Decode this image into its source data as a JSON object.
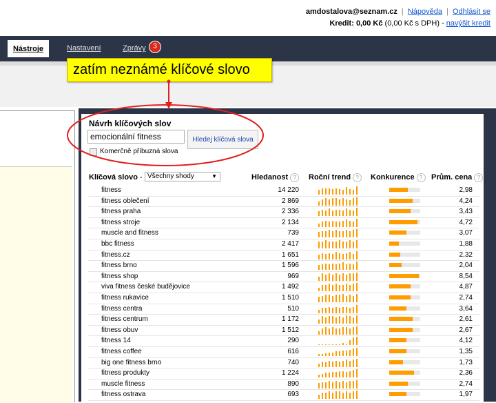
{
  "header": {
    "email": "amdostalova@seznam.cz",
    "help_link": "Nápověda",
    "logout_link": "Odhlásit se",
    "credit_label": "Kredit: 0,00 Kč",
    "credit_detail": "(0,00 Kč s DPH)",
    "credit_separator": "-",
    "topup_link": "navýšit kredit"
  },
  "tabs": [
    {
      "label": "Nástroje",
      "active": true
    },
    {
      "label": "Nastavení",
      "active": false
    },
    {
      "label": "Zprávy",
      "active": false
    }
  ],
  "notifications_badge": "3",
  "callout": {
    "text": "zatím neznámé klíčové slovo"
  },
  "suggest_panel": {
    "title": "Návrh klíčových slov",
    "input_value": "emocionální fitness",
    "search_button": "Hledej klíčová slova",
    "checkbox_label": "Komerčně příbuzná slova",
    "checkbox_checked": false
  },
  "table": {
    "col_keyword": "Klíčová slovo",
    "col_keyword_sep": "-",
    "filter_value": "Všechny shody",
    "col_searches": "Hledanost",
    "col_trend": "Roční trend",
    "col_competition": "Konkurence",
    "col_cpc": "Prům. cena",
    "help_icon": "?",
    "rows": [
      {
        "keyword": "fitness",
        "searches": "14 220",
        "competition": 0.6,
        "cpc": "2,98",
        "trend": [
          5,
          7,
          7,
          7,
          6,
          7,
          6,
          5,
          8,
          6,
          5,
          9
        ]
      },
      {
        "keyword": "fitness oblečení",
        "searches": "2 869",
        "competition": 0.75,
        "cpc": "4,24",
        "trend": [
          4,
          6,
          7,
          6,
          7,
          7,
          6,
          7,
          6,
          5,
          7,
          8
        ]
      },
      {
        "keyword": "fitness praha",
        "searches": "2 336",
        "competition": 0.7,
        "cpc": "3,43",
        "trend": [
          5,
          7,
          6,
          8,
          6,
          7,
          7,
          6,
          8,
          7,
          6,
          9
        ]
      },
      {
        "keyword": "fitness stroje",
        "searches": "2 134",
        "competition": 0.9,
        "cpc": "4,72",
        "trend": [
          4,
          6,
          7,
          6,
          7,
          6,
          6,
          7,
          8,
          7,
          6,
          9
        ]
      },
      {
        "keyword": "muscle and fitness",
        "searches": "739",
        "competition": 0.55,
        "cpc": "3,07",
        "trend": [
          5,
          6,
          6,
          7,
          6,
          7,
          6,
          6,
          7,
          6,
          7,
          8
        ]
      },
      {
        "keyword": "bbc fitness",
        "searches": "2 417",
        "competition": 0.3,
        "cpc": "1,88",
        "trend": [
          6,
          6,
          7,
          6,
          6,
          6,
          7,
          6,
          6,
          7,
          6,
          7
        ]
      },
      {
        "keyword": "fitness.cz",
        "searches": "1 651",
        "competition": 0.35,
        "cpc": "2,32",
        "trend": [
          5,
          7,
          6,
          7,
          6,
          8,
          7,
          6,
          7,
          8,
          6,
          9
        ]
      },
      {
        "keyword": "fitness brno",
        "searches": "1 596",
        "competition": 0.4,
        "cpc": "2,04",
        "trend": [
          5,
          6,
          7,
          6,
          7,
          6,
          7,
          8,
          6,
          7,
          6,
          9
        ]
      },
      {
        "keyword": "fitness shop",
        "searches": "969",
        "competition": 0.95,
        "cpc": "8,54",
        "trend": [
          4,
          7,
          6,
          7,
          6,
          7,
          6,
          7,
          6,
          7,
          7,
          8
        ]
      },
      {
        "keyword": "viva fitness české budějovice",
        "searches": "1 492",
        "competition": 0.7,
        "cpc": "4,87",
        "trend": [
          3,
          6,
          6,
          7,
          6,
          7,
          6,
          6,
          7,
          6,
          7,
          8
        ]
      },
      {
        "keyword": "fitness rukavice",
        "searches": "1 510",
        "competition": 0.7,
        "cpc": "2,74",
        "trend": [
          5,
          6,
          7,
          7,
          6,
          7,
          7,
          8,
          6,
          7,
          6,
          8
        ]
      },
      {
        "keyword": "fitness centra",
        "searches": "510",
        "competition": 0.55,
        "cpc": "3,64",
        "trend": [
          4,
          6,
          6,
          7,
          6,
          7,
          6,
          7,
          7,
          6,
          7,
          9
        ]
      },
      {
        "keyword": "fitness centrum",
        "searches": "1 172",
        "competition": 0.75,
        "cpc": "2,61",
        "trend": [
          4,
          7,
          6,
          7,
          7,
          6,
          7,
          6,
          8,
          7,
          6,
          8
        ]
      },
      {
        "keyword": "fitness obuv",
        "searches": "1 512",
        "competition": 0.75,
        "cpc": "2,67",
        "trend": [
          3,
          6,
          7,
          6,
          7,
          6,
          6,
          7,
          7,
          6,
          7,
          8
        ]
      },
      {
        "keyword": "fitness 14",
        "searches": "290",
        "competition": 0.55,
        "cpc": "4,12",
        "trend": [
          1,
          1,
          1,
          1,
          1,
          1,
          1,
          2,
          1,
          5,
          8,
          9
        ]
      },
      {
        "keyword": "fitness coffee",
        "searches": "616",
        "competition": 0.55,
        "cpc": "1,35",
        "trend": [
          2,
          2,
          3,
          4,
          4,
          5,
          5,
          6,
          6,
          7,
          8,
          9
        ]
      },
      {
        "keyword": "big one fitness brno",
        "searches": "740",
        "competition": 0.45,
        "cpc": "1,73",
        "trend": [
          4,
          6,
          5,
          7,
          6,
          7,
          6,
          7,
          8,
          7,
          8,
          9
        ]
      },
      {
        "keyword": "fitness produkty",
        "searches": "1 224",
        "competition": 0.8,
        "cpc": "2,36",
        "trend": [
          3,
          4,
          5,
          5,
          6,
          6,
          7,
          7,
          6,
          7,
          8,
          9
        ]
      },
      {
        "keyword": "muscle fitness",
        "searches": "890",
        "competition": 0.6,
        "cpc": "2,74",
        "trend": [
          5,
          6,
          6,
          7,
          6,
          7,
          6,
          7,
          6,
          7,
          7,
          8
        ]
      },
      {
        "keyword": "fitness ostrava",
        "searches": "693",
        "competition": 0.55,
        "cpc": "1,97",
        "trend": [
          4,
          6,
          6,
          7,
          6,
          7,
          7,
          6,
          7,
          6,
          7,
          8
        ]
      }
    ]
  },
  "colors": {
    "navbar": "#2b3547",
    "accent_bar": "#ff9c00",
    "callout": "#ffff00",
    "annotation": "#e02020",
    "badge": "#d52b1e"
  }
}
